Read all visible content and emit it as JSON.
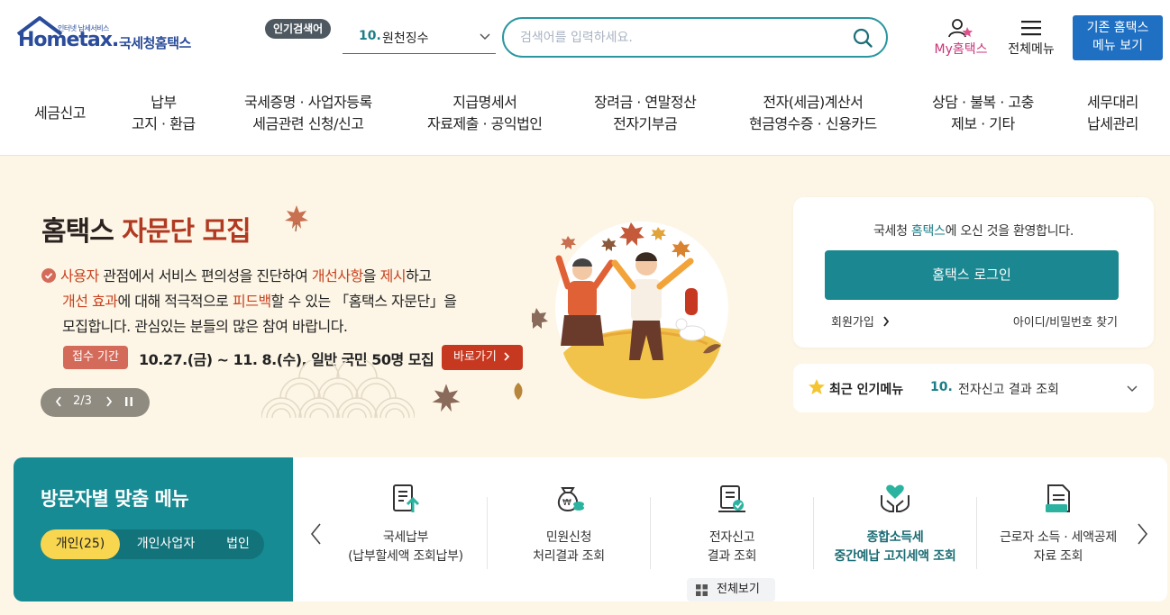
{
  "header": {
    "logo_small": "인터넷 납세서비스",
    "logo_main": "Hometax.",
    "logo_sub": "국세청홈택스",
    "popular_badge": "인기검색어",
    "popular_rank": "10.",
    "popular_term": "원천징수",
    "search_placeholder": "검색어를 입력하세요.",
    "my_hometax": "My홈택스",
    "all_menu": "전체메뉴",
    "old_menu_line1": "기존 홈택스",
    "old_menu_line2": "메뉴 보기"
  },
  "gnb": [
    {
      "line1": "세금신고",
      "line2": ""
    },
    {
      "line1": "납부",
      "line2": "고지 · 환급"
    },
    {
      "line1": "국세증명 · 사업자등록",
      "line2": "세금관련 신청/신고"
    },
    {
      "line1": "지급명세서",
      "line2": "자료제출 · 공익법인"
    },
    {
      "line1": "장려금 · 연말정산",
      "line2": "전자기부금"
    },
    {
      "line1": "전자(세금)계산서",
      "line2": "현금영수증 · 신용카드"
    },
    {
      "line1": "상담 · 불복 · 고충",
      "line2": "제보 · 기타"
    },
    {
      "line1": "세무대리",
      "line2": "납세관리"
    }
  ],
  "banner": {
    "title_a": "홈택스 ",
    "title_b": "자문단 모집",
    "desc": {
      "p1": "사용자",
      "p2": " 관점에서 서비스 편의성을 진단하여 ",
      "p3": "개선사항",
      "p4": "을 ",
      "p5": "제시",
      "p6": "하고",
      "p7": "개선 효과",
      "p8": "에 대해 적극적으로 ",
      "p9": "피드백",
      "p10": "할 수 있는 「홈택스 자문단」을",
      "p11": "모집합니다. 관심있는 분들의 많은 참여 바랍니다."
    },
    "period_label": "접수 기간",
    "period_text": "10.27.(금) ~ 11. 8.(수), 일반 국민 50명 모집",
    "goto_label": "바로가기",
    "pager": "2/3"
  },
  "login": {
    "welcome_a": "국세청 ",
    "welcome_brand": "홈택스",
    "welcome_b": "에 오신 것을 환영합니다.",
    "login_button": "홈택스 로그인",
    "signup": "회원가입",
    "find_id": "아이디/비밀번호 찾기"
  },
  "recent": {
    "label": "최근 인기메뉴",
    "rank": "10.",
    "text": "전자신고 결과 조회"
  },
  "visitor": {
    "title": "방문자별 맞춤 메뉴",
    "tabs": [
      "개인(25)",
      "개인사업자",
      "법인"
    ]
  },
  "quick_menu": [
    {
      "line1": "국세납부",
      "line2": "(납부할세액 조회납부)",
      "icon": "tax-payment-icon"
    },
    {
      "line1": "민원신청",
      "line2": "처리결과 조회",
      "icon": "money-bag-icon"
    },
    {
      "line1": "전자신고",
      "line2": "결과 조회",
      "icon": "e-filing-icon"
    },
    {
      "line1": "종합소득세",
      "line2": "중간예납 고지세액 조회",
      "icon": "heart-hands-icon"
    },
    {
      "line1": "근로자 소득 · 세액공제",
      "line2": "자료 조회",
      "icon": "document-icon"
    }
  ],
  "view_all": "전체보기",
  "colors": {
    "brand_blue": "#2a4c9a",
    "teal": "#1a8791",
    "banner_bg": "#fdf6e6",
    "accent_red": "#c73820"
  }
}
